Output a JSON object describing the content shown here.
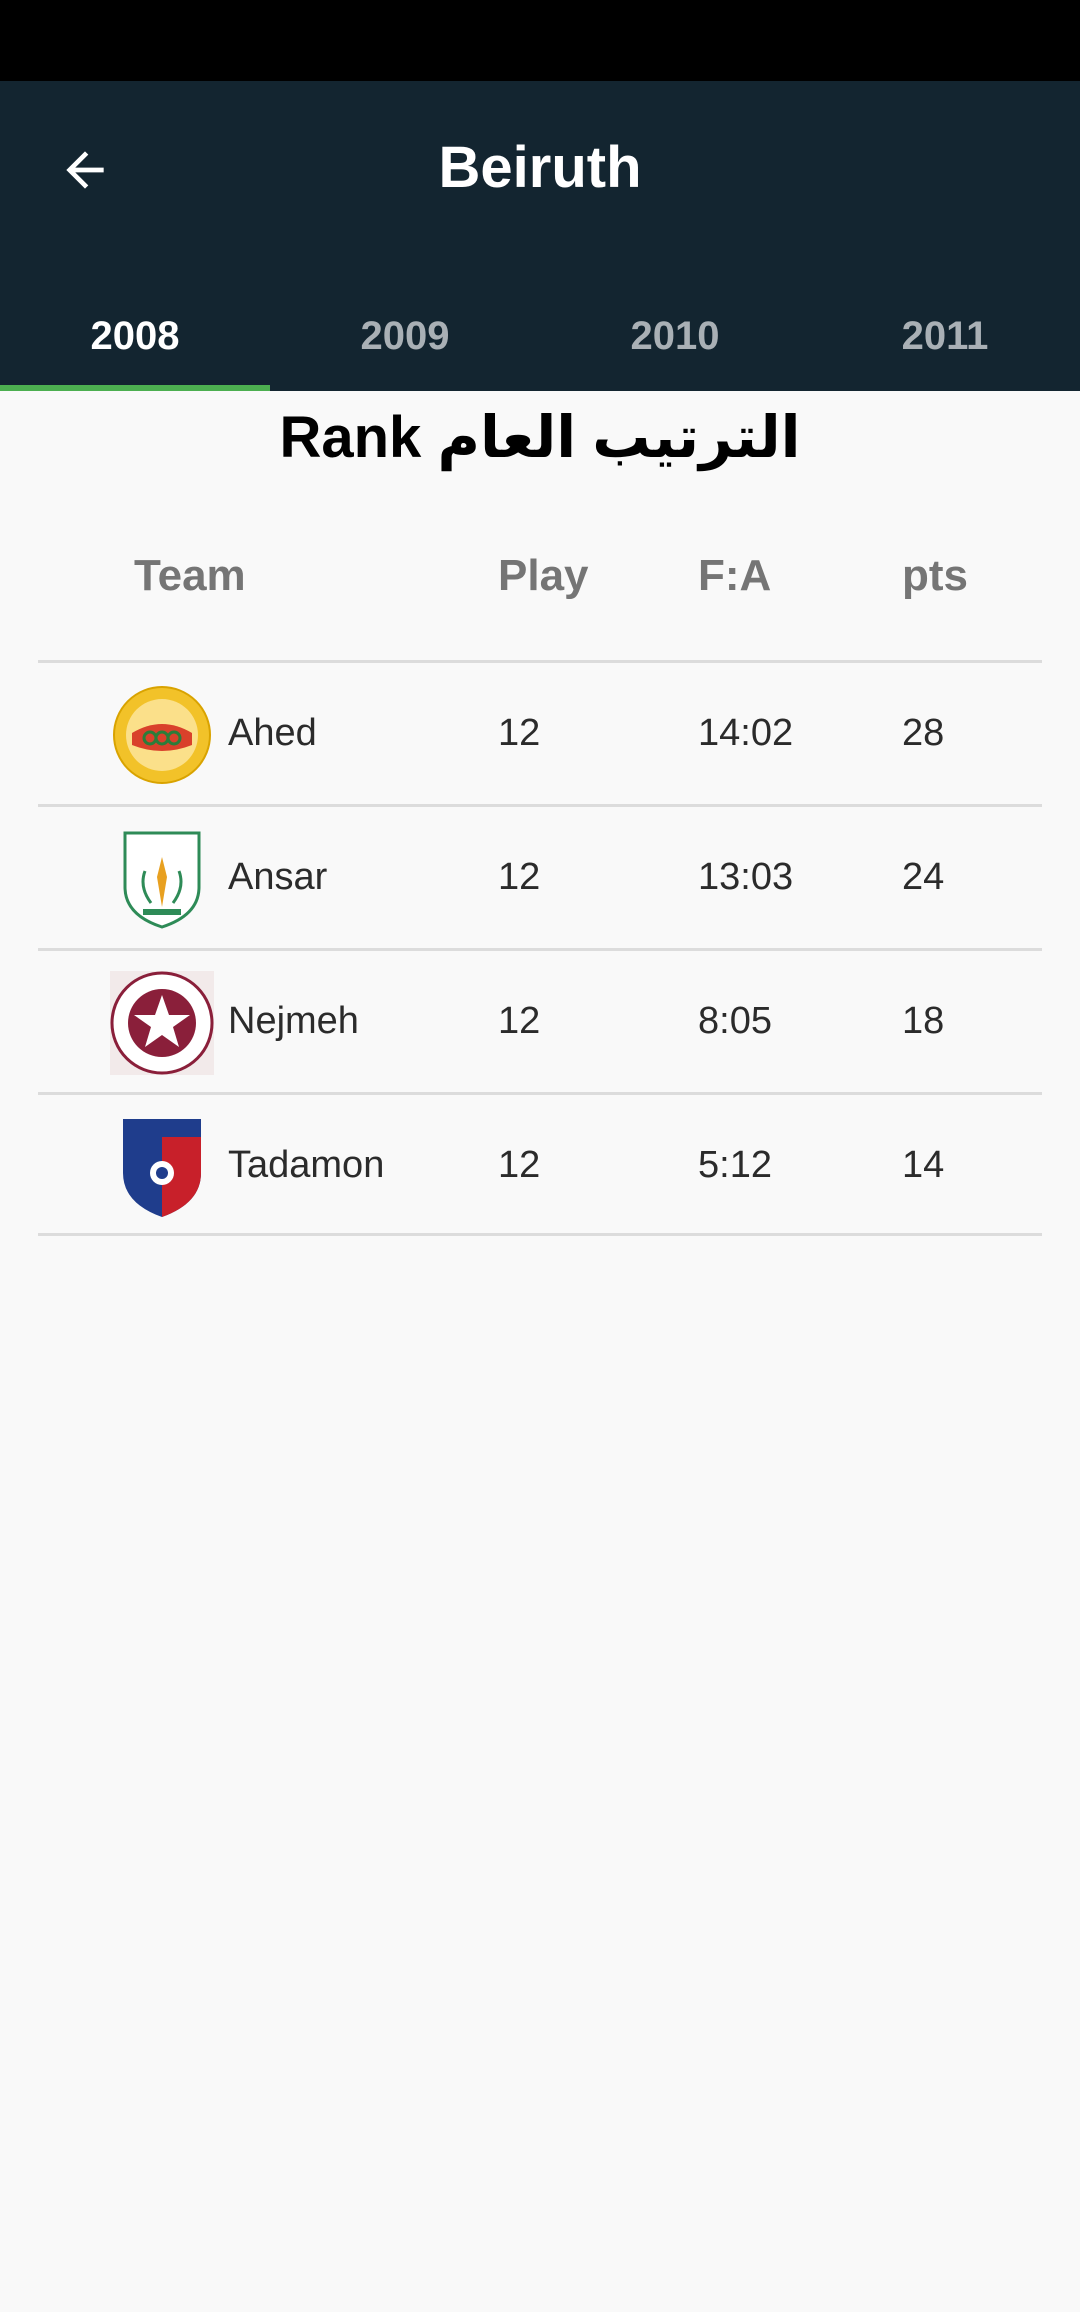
{
  "app": {
    "title": "Beiruth"
  },
  "tabs": [
    {
      "label": "2008",
      "active": true
    },
    {
      "label": "2009",
      "active": false
    },
    {
      "label": "2010",
      "active": false
    },
    {
      "label": "2011",
      "active": false
    }
  ],
  "table": {
    "title": "Rank الترتيب العام",
    "headers": {
      "team": "Team",
      "play": "Play",
      "fa": "F:A",
      "pts": "pts"
    },
    "rows": [
      {
        "team": "Ahed",
        "play": "12",
        "fa": "14:02",
        "pts": "28",
        "logo": "ahed-logo"
      },
      {
        "team": "Ansar",
        "play": "12",
        "fa": "13:03",
        "pts": "24",
        "logo": "ansar-logo"
      },
      {
        "team": "Nejmeh",
        "play": "12",
        "fa": "8:05",
        "pts": "18",
        "logo": "nejmeh-logo"
      },
      {
        "team": "Tadamon",
        "play": "12",
        "fa": "5:12",
        "pts": "14",
        "logo": "tadamon-logo"
      }
    ]
  },
  "colors": {
    "app_bar": "#132530",
    "tab_indicator": "#4caf50",
    "background": "#f9f9f9"
  },
  "icons": {
    "back": "arrow-back-icon"
  }
}
